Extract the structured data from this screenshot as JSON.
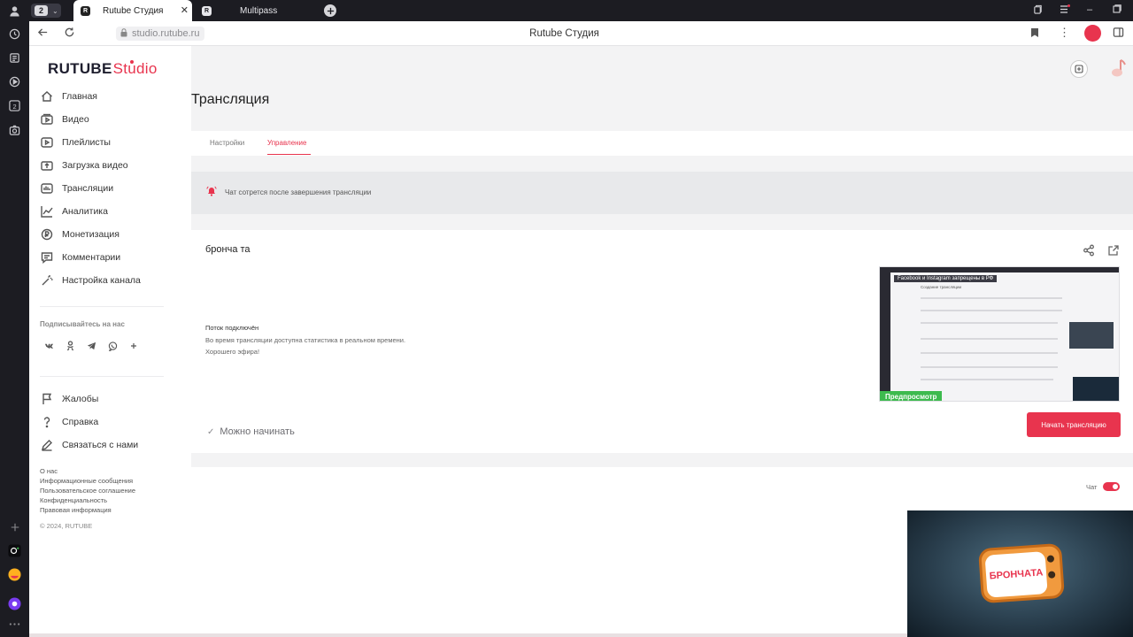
{
  "browser": {
    "tab_count": "2",
    "tabs": [
      {
        "title": "Rutube Студия"
      },
      {
        "title": "Multipass"
      }
    ],
    "url": "studio.rutube.ru",
    "page_title": "Rutube Студия",
    "icons": [
      "profile-icon",
      "history-icon",
      "notes-icon",
      "play-icon",
      "two-icon",
      "screenshot-icon",
      "add-icon",
      "camera-icon",
      "yandex-icon",
      "alice-icon",
      "more-icon"
    ]
  },
  "logo": {
    "brand": "RUTUBE",
    "product": "Studio"
  },
  "sidebar": {
    "items": [
      {
        "label": "Главная",
        "icon": "home-icon"
      },
      {
        "label": "Видео",
        "icon": "video-icon"
      },
      {
        "label": "Плейлисты",
        "icon": "playlist-icon"
      },
      {
        "label": "Загрузка видео",
        "icon": "upload-icon"
      },
      {
        "label": "Трансляции",
        "icon": "stream-icon"
      },
      {
        "label": "Аналитика",
        "icon": "analytics-icon"
      },
      {
        "label": "Монетизация",
        "icon": "money-icon"
      },
      {
        "label": "Комментарии",
        "icon": "comments-icon"
      },
      {
        "label": "Настройка канала",
        "icon": "wand-icon"
      }
    ],
    "subscribe_title": "Подписывайтесь на нас",
    "socials": [
      {
        "glyph": "vk",
        "icon": "vk-icon"
      },
      {
        "glyph": "ok",
        "icon": "ok-icon"
      },
      {
        "glyph": "tg",
        "icon": "telegram-icon"
      },
      {
        "glyph": "wa",
        "icon": "viber-icon"
      },
      {
        "glyph": "+",
        "icon": "more-icon"
      }
    ],
    "help_items": [
      {
        "label": "Жалобы",
        "icon": "flag-icon"
      },
      {
        "label": "Справка",
        "icon": "help-icon"
      },
      {
        "label": "Связаться с нами",
        "icon": "edit-icon"
      }
    ],
    "footer_links": [
      "О нас",
      "Информационные сообщения",
      "Пользовательское соглашение",
      "Конфиденциальность",
      "Правовая информация"
    ],
    "copyright": "© 2024, RUTUBE"
  },
  "main": {
    "title": "Трансляция",
    "tabs": [
      {
        "label": "Настройки"
      },
      {
        "label": "Управление"
      }
    ],
    "notice": "Чат сотрется после завершения трансляции",
    "stream": {
      "name": "бронча та",
      "status_title": "Поток подключён",
      "status_lines": [
        "Во время трансляции доступна статистика в реальном времени.",
        "Хорошего эфира!"
      ],
      "ready_text": "Можно начинать",
      "preview_badge": "Предпросмотр",
      "preview_banner": "Facebook и Instagram запрещены в РФ",
      "preview_inner": "Создание трансляции",
      "start_button": "Начать трансляцию"
    },
    "chat_label": "Чат",
    "chat_enabled": true,
    "overlay_text": "БРОНЧАТА"
  },
  "colors": {
    "accent": "#e8344e",
    "badge": "#3dba4e",
    "dark_chrome": "#1c1c22"
  }
}
